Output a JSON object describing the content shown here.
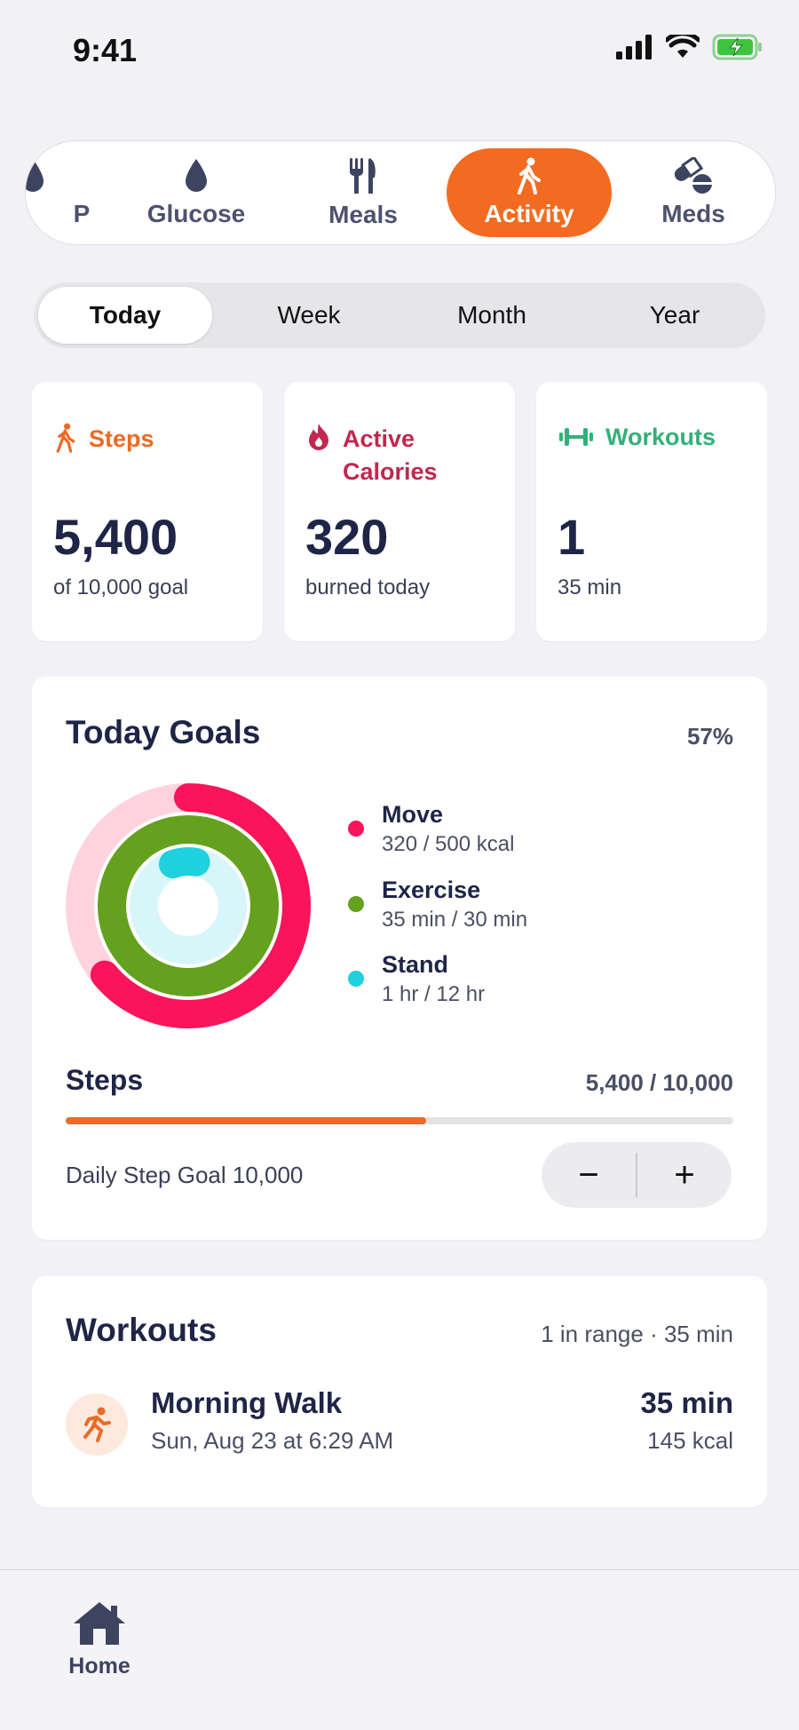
{
  "status": {
    "time": "9:41"
  },
  "categories": [
    {
      "label": "P",
      "icon": "drop-icon"
    },
    {
      "label": "Glucose",
      "icon": "drop-icon"
    },
    {
      "label": "Meals",
      "icon": "fork-knife-icon"
    },
    {
      "label": "Activity",
      "icon": "walking-icon",
      "active": true
    },
    {
      "label": "Meds",
      "icon": "pills-icon"
    }
  ],
  "periods": [
    "Today",
    "Week",
    "Month",
    "Year"
  ],
  "metrics": {
    "steps": {
      "title": "Steps",
      "value": "5,400",
      "sub": "of 10,000 goal",
      "color": "#ea6b25"
    },
    "calories": {
      "title_line1": "Active",
      "title_line2": "Calories",
      "value": "320",
      "sub": "burned today",
      "color": "#c0284e"
    },
    "workouts": {
      "title": "Workouts",
      "value": "1",
      "sub": "35 min",
      "color": "#33b07a"
    }
  },
  "goals": {
    "title": "Today Goals",
    "percent": "57%",
    "rings": [
      {
        "name": "Move",
        "value": "320 / 500 kcal",
        "color": "#fa1459",
        "fraction": 0.64
      },
      {
        "name": "Exercise",
        "value": "35 min / 30 min",
        "color": "#63a11e",
        "fraction": 1.0
      },
      {
        "name": "Stand",
        "value": "1 hr / 12 hr",
        "color": "#1fd0df",
        "fraction": 0.083
      }
    ],
    "steps_label": "Steps",
    "steps_value": "5,400 / 10,000",
    "steps_fraction": 0.54,
    "daily_goal": "Daily Step Goal 10,000",
    "minus": "−",
    "plus": "+"
  },
  "workouts": {
    "title": "Workouts",
    "summary": "1 in range · 35 min",
    "items": [
      {
        "name": "Morning Walk",
        "date": "Sun, Aug 23 at 6:29 AM",
        "duration": "35 min",
        "kcal": "145 kcal"
      }
    ]
  },
  "tabbar": {
    "home": "Home"
  }
}
